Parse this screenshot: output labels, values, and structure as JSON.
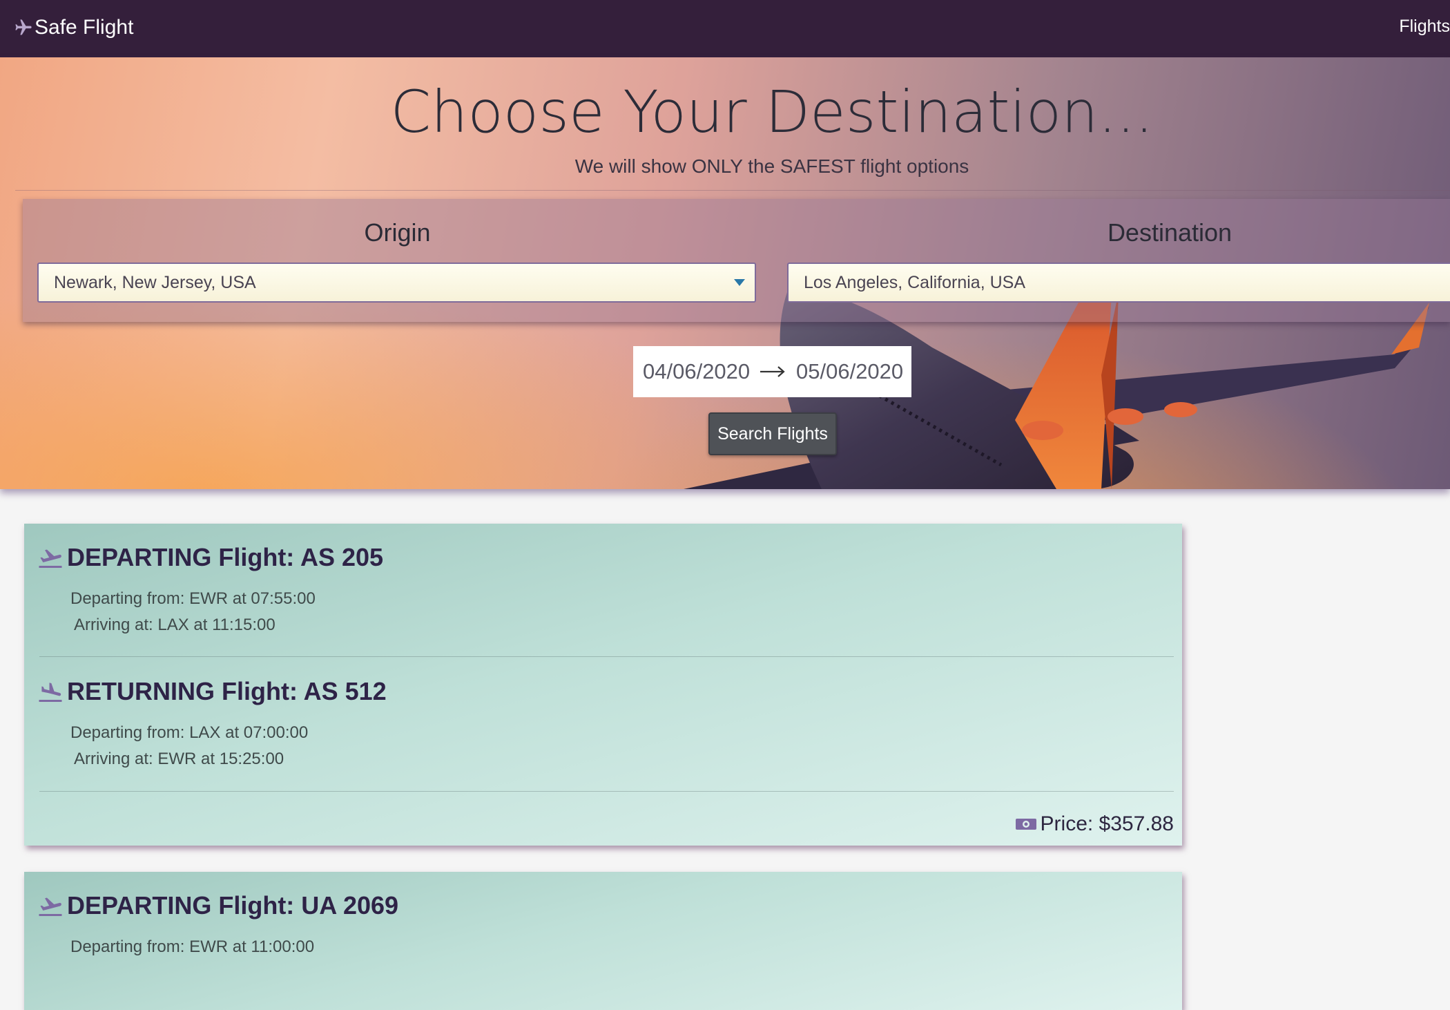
{
  "navbar": {
    "brand": "Safe Flight",
    "brand_icon": "airplane-icon",
    "links": [
      "Flights"
    ]
  },
  "hero": {
    "title": "Choose Your Destination...",
    "subtitle": "We will show ONLY the SAFEST flight options",
    "origin": {
      "label": "Origin",
      "value": "Newark, New Jersey, USA"
    },
    "destination": {
      "label": "Destination",
      "value": "Los Angeles, California, USA"
    },
    "dates": {
      "start": "04/06/2020",
      "end": "05/06/2020"
    },
    "search_label": "Search Flights"
  },
  "results": [
    {
      "departing": {
        "title": "DEPARTING Flight: AS 205",
        "from": "Departing from: EWR at 07:55:00",
        "to": "Arriving at: LAX at 11:15:00"
      },
      "returning": {
        "title": "RETURNING Flight: AS 512",
        "from": "Departing from: LAX at 07:00:00",
        "to": "Arriving at: EWR at 15:25:00"
      },
      "price": "Price: $357.88"
    },
    {
      "departing": {
        "title": "DEPARTING Flight: UA 2069",
        "from": "Departing from: EWR at 11:00:00"
      }
    }
  ],
  "colors": {
    "navbar": "#341f3b",
    "heading": "#2e2347",
    "card_start": "#9fc8bf",
    "card_end": "#dff2ee",
    "button": "#4f5257"
  }
}
